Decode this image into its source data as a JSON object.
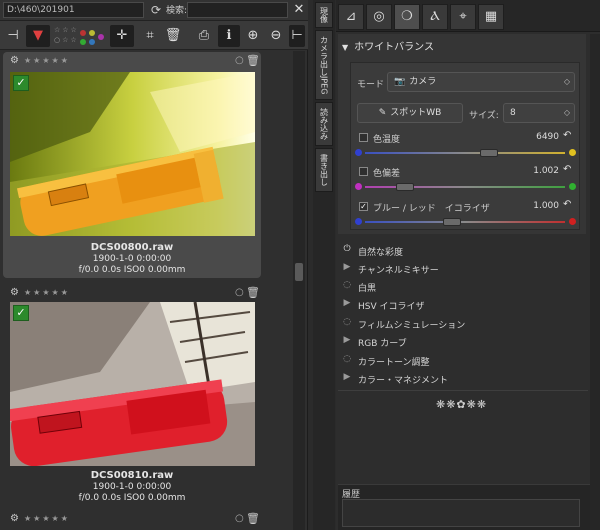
{
  "browser": {
    "path": "D:\\460\\201901",
    "search_label": "検索:",
    "search_value": "",
    "close_icon": "close-icon"
  },
  "thumbs": [
    {
      "filename": "DCS00800.raw",
      "date": "1900-1-0 0:00:00",
      "exif": "f/0.0 0.0s ISO0 0.00mm",
      "rating_stars": "★★★★★",
      "checked_mark": "✓"
    },
    {
      "filename": "DCS00810.raw",
      "date": "1900-1-0 0:00:00",
      "exif": "f/0.0 0.0s ISO0 0.00mm",
      "rating_stars": "★★★★★",
      "checked_mark": "✓"
    }
  ],
  "third_stars": "★★★★★",
  "vertical_tabs": [
    "現像",
    "カメラ出しJPEG",
    "読み込み",
    "書き出し"
  ],
  "white_balance": {
    "title": "ホワイトバランス",
    "mode_label": "モード",
    "mode_value": "カメラ",
    "spot_wb_label": "スポットWB",
    "size_label": "サイズ:",
    "size_value": "8",
    "temperature_label": "色温度",
    "temperature_value": "6490",
    "tint_label": "色偏差",
    "tint_value": "1.002",
    "equalizer_label": "ブルー / レッド　イコライザ",
    "equalizer_value": "1.000",
    "equalizer_checked": "✓"
  },
  "tools": [
    {
      "icon": "⏻",
      "label": "自然な彩度"
    },
    {
      "icon": "▶",
      "label": "チャンネルミキサー"
    },
    {
      "icon": "◌",
      "label": "白黒"
    },
    {
      "icon": "▶",
      "label": "HSV イコライザ"
    },
    {
      "icon": "◌",
      "label": "フィルムシミュレーション"
    },
    {
      "icon": "▶",
      "label": "RGB カーブ"
    },
    {
      "icon": "◌",
      "label": "カラートーン調整"
    },
    {
      "icon": "▶",
      "label": "カラー・マネジメント"
    }
  ],
  "ornament": "❋❋✿❋❋",
  "history_label": "履歴",
  "colors": {
    "accent_green": "#2c8a2c",
    "panel": "#2d2d2d"
  }
}
